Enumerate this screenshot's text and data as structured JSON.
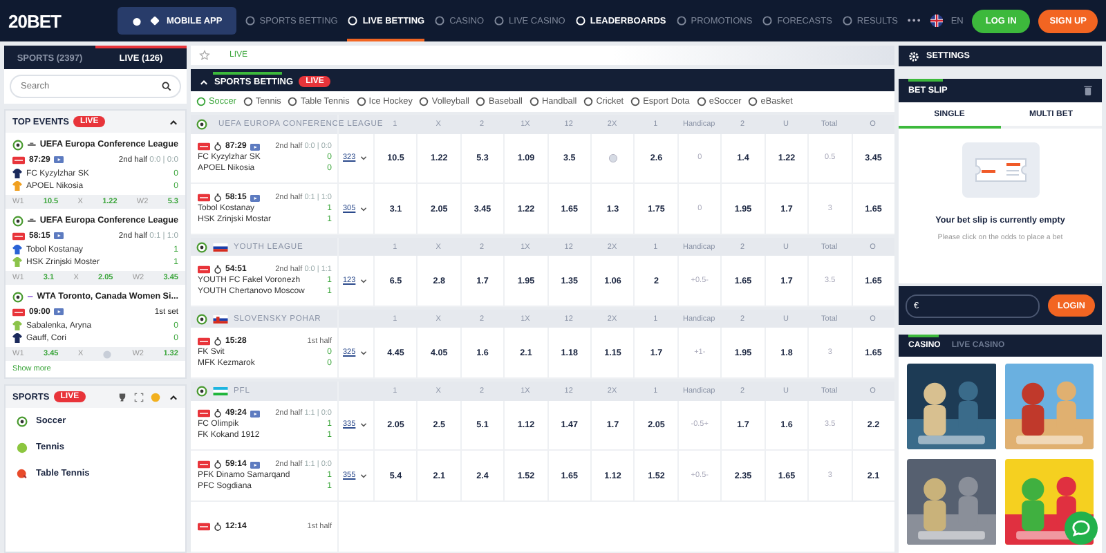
{
  "header": {
    "logo": "20BET",
    "mobile_app": "MOBILE APP",
    "nav": [
      {
        "label": "SPORTS BETTING",
        "selected": false,
        "highlighted": false
      },
      {
        "label": "LIVE BETTING",
        "selected": true,
        "highlighted": false
      },
      {
        "label": "CASINO",
        "selected": false,
        "highlighted": false
      },
      {
        "label": "LIVE CASINO",
        "selected": false,
        "highlighted": false
      },
      {
        "label": "LEADERBOARDS",
        "selected": false,
        "highlighted": true
      },
      {
        "label": "PROMOTIONS",
        "selected": false,
        "highlighted": false
      },
      {
        "label": "FORECASTS",
        "selected": false,
        "highlighted": false
      },
      {
        "label": "RESULTS",
        "selected": false,
        "highlighted": false
      }
    ],
    "more": "•••",
    "language": "EN",
    "login": "LOG IN",
    "signup": "SIGN UP"
  },
  "left": {
    "tabs": [
      {
        "label": "SPORTS (2397)",
        "selected": false
      },
      {
        "label": "LIVE (126)",
        "selected": true
      }
    ],
    "search": {
      "placeholder": "Search"
    },
    "top_events": {
      "title": "TOP EVENTS",
      "badge": "LIVE",
      "events": [
        {
          "kind": "conference",
          "league": "UEFA Europa Conference League",
          "time": "87:29",
          "stream": true,
          "status": "2nd half",
          "score_detail": "0:0 | 0:0",
          "teams": [
            {
              "name": "FC Kyzylzhar SK",
              "score": "0",
              "color": "#1b2a5c"
            },
            {
              "name": "APOEL Nikosia",
              "score": "0",
              "color": "#f0a020"
            }
          ],
          "odds": [
            {
              "label": "W1",
              "value": "10.5",
              "locked": false
            },
            {
              "label": "X",
              "value": "1.22",
              "locked": false
            },
            {
              "label": "W2",
              "value": "5.3",
              "locked": false
            }
          ]
        },
        {
          "kind": "conference",
          "league": "UEFA Europa Conference League",
          "time": "58:15",
          "stream": true,
          "status": "2nd half",
          "score_detail": "0:1 | 1:0",
          "teams": [
            {
              "name": "Tobol Kostanay",
              "score": "1",
              "color": "#2a63d6"
            },
            {
              "name": "HSK Zrinjski Moster",
              "score": "1",
              "color": "#8bc34a"
            }
          ],
          "odds": [
            {
              "label": "W1",
              "value": "3.1",
              "locked": false
            },
            {
              "label": "X",
              "value": "2.05",
              "locked": false
            },
            {
              "label": "W2",
              "value": "3.45",
              "locked": false
            }
          ]
        },
        {
          "kind": "wta",
          "league": "WTA Toronto, Canada Women Si...",
          "time": "09:00",
          "stream": true,
          "status": "1st set",
          "teams": [
            {
              "name": "Sabalenka, Aryna",
              "score": "0",
              "color": "#8bc34a"
            },
            {
              "name": "Gauff, Cori",
              "score": "0",
              "color": "#1b2a5c"
            }
          ],
          "odds": [
            {
              "label": "W1",
              "value": "3.45",
              "locked": false
            },
            {
              "label": "X",
              "locked": true
            },
            {
              "label": "W2",
              "value": "1.32",
              "locked": false
            }
          ]
        }
      ],
      "show_more": "Show more"
    },
    "sports": {
      "title": "SPORTS",
      "badge": "LIVE",
      "items": [
        {
          "label": "Soccer",
          "kind": "soccer"
        },
        {
          "label": "Tennis",
          "kind": "tennis"
        },
        {
          "label": "Table Tennis",
          "kind": "table-tennis"
        }
      ]
    }
  },
  "center": {
    "breadcrumb": "LIVE",
    "title": "SPORTS BETTING",
    "badge": "LIVE",
    "sport_tabs": [
      {
        "label": "Soccer",
        "selected": true
      },
      {
        "label": "Tennis",
        "selected": false
      },
      {
        "label": "Table Tennis",
        "selected": false
      },
      {
        "label": "Ice Hockey",
        "selected": false
      },
      {
        "label": "Volleyball",
        "selected": false
      },
      {
        "label": "Baseball",
        "selected": false
      },
      {
        "label": "Handball",
        "selected": false
      },
      {
        "label": "Cricket",
        "selected": false
      },
      {
        "label": "Esport Dota",
        "selected": false
      },
      {
        "label": "eSoccer",
        "selected": false
      },
      {
        "label": "eBasket",
        "selected": false
      }
    ],
    "groups": [
      {
        "kind": "conference",
        "name": "UEFA EUROPA CONFERENCE LEAGUE",
        "columns": [
          "1",
          "X",
          "2",
          "1X",
          "12",
          "2X",
          "1",
          "Handicap",
          "2",
          "U",
          "Total",
          "O"
        ],
        "events": [
          {
            "time": "87:29",
            "stream": true,
            "status": "2nd half",
            "score_detail": "0:0 | 0:0",
            "teams": [
              {
                "name": "FC Kyzylzhar SK",
                "score": "0"
              },
              {
                "name": "APOEL Nikosia",
                "score": "0"
              }
            ],
            "count": "323",
            "odds": [
              {
                "value": "10.5",
                "locked": false
              },
              {
                "value": "1.22",
                "locked": false
              },
              {
                "value": "5.3",
                "locked": false
              },
              {
                "value": "1.09",
                "locked": false
              },
              {
                "value": "3.5",
                "locked": false
              },
              {
                "locked": true
              },
              {
                "value": "2.6",
                "locked": false
              },
              {
                "value": "0",
                "locked": false
              },
              {
                "value": "1.4",
                "locked": false
              },
              {
                "value": "1.22",
                "locked": false
              },
              {
                "value": "0.5",
                "locked": false
              },
              {
                "value": "3.45",
                "locked": false
              }
            ]
          },
          {
            "time": "58:15",
            "stream": true,
            "status": "2nd half",
            "score_detail": "0:1 | 1:0",
            "teams": [
              {
                "name": "Tobol Kostanay",
                "score": "1"
              },
              {
                "name": "HSK Zrinjski Mostar",
                "score": "1"
              }
            ],
            "count": "305",
            "odds": [
              {
                "value": "3.1",
                "locked": false
              },
              {
                "value": "2.05",
                "locked": false
              },
              {
                "value": "3.45",
                "locked": false
              },
              {
                "value": "1.22",
                "locked": false
              },
              {
                "value": "1.65",
                "locked": false
              },
              {
                "value": "1.3",
                "locked": false
              },
              {
                "value": "1.75",
                "locked": false
              },
              {
                "value": "0",
                "locked": false
              },
              {
                "value": "1.95",
                "locked": false
              },
              {
                "value": "1.7",
                "locked": false
              },
              {
                "value": "3",
                "locked": false
              },
              {
                "value": "1.65",
                "locked": false
              }
            ]
          }
        ]
      },
      {
        "kind": "ru",
        "name": "YOUTH LEAGUE",
        "columns": [
          "1",
          "X",
          "2",
          "1X",
          "12",
          "2X",
          "1",
          "Handicap",
          "2",
          "U",
          "Total",
          "O"
        ],
        "events": [
          {
            "time": "54:51",
            "stream": false,
            "status": "2nd half",
            "score_detail": "0:0 | 1:1",
            "teams": [
              {
                "name": "YOUTH FC Fakel Voronezh",
                "score": "1"
              },
              {
                "name": "YOUTH Chertanovo Moscow",
                "score": "1"
              }
            ],
            "count": "123",
            "odds": [
              {
                "value": "6.5",
                "locked": false
              },
              {
                "value": "2.8",
                "locked": false
              },
              {
                "value": "1.7",
                "locked": false
              },
              {
                "value": "1.95",
                "locked": false
              },
              {
                "value": "1.35",
                "locked": false
              },
              {
                "value": "1.06",
                "locked": false
              },
              {
                "value": "2",
                "locked": false
              },
              {
                "value": "+0.5-",
                "locked": false
              },
              {
                "value": "1.65",
                "locked": false
              },
              {
                "value": "1.7",
                "locked": false
              },
              {
                "value": "3.5",
                "locked": false
              },
              {
                "value": "1.65",
                "locked": false
              }
            ]
          }
        ]
      },
      {
        "kind": "sk",
        "name": "SLOVENSKY POHAR",
        "columns": [
          "1",
          "X",
          "2",
          "1X",
          "12",
          "2X",
          "1",
          "Handicap",
          "2",
          "U",
          "Total",
          "O"
        ],
        "events": [
          {
            "time": "15:28",
            "stream": false,
            "status": "1st half",
            "teams": [
              {
                "name": "FK Svit",
                "score": "0"
              },
              {
                "name": "MFK Kezmarok",
                "score": "0"
              }
            ],
            "count": "325",
            "odds": [
              {
                "value": "4.45",
                "locked": false
              },
              {
                "value": "4.05",
                "locked": false
              },
              {
                "value": "1.6",
                "locked": false
              },
              {
                "value": "2.1",
                "locked": false
              },
              {
                "value": "1.18",
                "locked": false
              },
              {
                "value": "1.15",
                "locked": false
              },
              {
                "value": "1.7",
                "locked": false
              },
              {
                "value": "+1-",
                "locked": false
              },
              {
                "value": "1.95",
                "locked": false
              },
              {
                "value": "1.8",
                "locked": false
              },
              {
                "value": "3",
                "locked": false
              },
              {
                "value": "1.65",
                "locked": false
              }
            ]
          }
        ]
      },
      {
        "kind": "uz",
        "name": "PFL",
        "columns": [
          "1",
          "X",
          "2",
          "1X",
          "12",
          "2X",
          "1",
          "Handicap",
          "2",
          "U",
          "Total",
          "O"
        ],
        "events": [
          {
            "time": "49:24",
            "stream": true,
            "status": "2nd half",
            "score_detail": "1:1 | 0:0",
            "teams": [
              {
                "name": "FC Olimpik",
                "score": "1"
              },
              {
                "name": "FK Kokand 1912",
                "score": "1"
              }
            ],
            "count": "335",
            "odds": [
              {
                "value": "2.05",
                "locked": false
              },
              {
                "value": "2.5",
                "locked": false
              },
              {
                "value": "5.1",
                "locked": false
              },
              {
                "value": "1.12",
                "locked": false
              },
              {
                "value": "1.47",
                "locked": false
              },
              {
                "value": "1.7",
                "locked": false
              },
              {
                "value": "2.05",
                "locked": false
              },
              {
                "value": "-0.5+",
                "locked": false
              },
              {
                "value": "1.7",
                "locked": false
              },
              {
                "value": "1.6",
                "locked": false
              },
              {
                "value": "3.5",
                "locked": false
              },
              {
                "value": "2.2",
                "locked": false
              }
            ]
          },
          {
            "time": "59:14",
            "stream": true,
            "status": "2nd half",
            "score_detail": "1:1 | 0:0",
            "teams": [
              {
                "name": "PFK Dinamo Samarqand",
                "score": "1"
              },
              {
                "name": "PFC Sogdiana",
                "score": "1"
              }
            ],
            "count": "355",
            "odds": [
              {
                "value": "5.4",
                "locked": false
              },
              {
                "value": "2.1",
                "locked": false
              },
              {
                "value": "2.4",
                "locked": false
              },
              {
                "value": "1.52",
                "locked": false
              },
              {
                "value": "1.65",
                "locked": false
              },
              {
                "value": "1.12",
                "locked": false
              },
              {
                "value": "1.52",
                "locked": false
              },
              {
                "value": "+0.5-",
                "locked": false
              },
              {
                "value": "2.35",
                "locked": false
              },
              {
                "value": "1.65",
                "locked": false
              },
              {
                "value": "3",
                "locked": false
              },
              {
                "value": "2.1",
                "locked": false
              }
            ]
          },
          {
            "time": "12:14",
            "stream": false,
            "status": "1st half"
          }
        ]
      }
    ]
  },
  "right": {
    "settings": "SETTINGS",
    "betslip": {
      "title": "BET SLIP",
      "tabs": [
        {
          "label": "SINGLE",
          "selected": true
        },
        {
          "label": "MULTI BET",
          "selected": false
        }
      ],
      "empty_title": "Your bet slip is currently empty",
      "empty_hint": "Please click on the odds to place a bet",
      "currency": "€",
      "login": "LOGIN"
    },
    "casino": {
      "tabs": [
        {
          "label": "CASINO",
          "selected": true
        },
        {
          "label": "LIVE CASINO",
          "selected": false
        }
      ]
    }
  }
}
